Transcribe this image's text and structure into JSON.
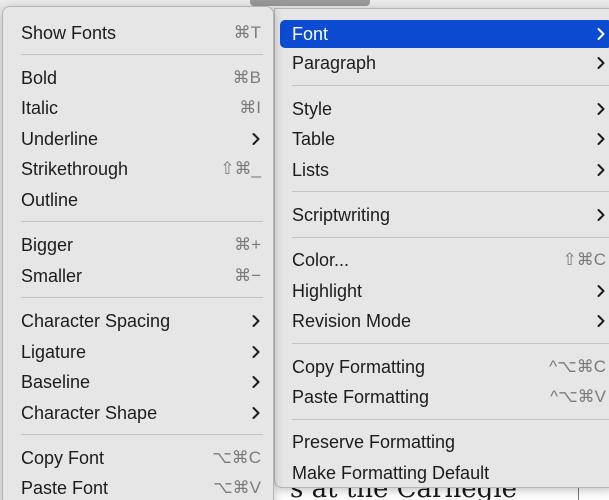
{
  "colors": {
    "accent": "#0a4bd1",
    "menu_bg": "#e6e6e6",
    "shortcut_gray": "#7b7b7b"
  },
  "document": {
    "visible_text": "s at the Carnegie"
  },
  "left_menu": {
    "items": [
      {
        "label": "Show Fonts",
        "shortcut": "⌘T"
      },
      {
        "label": "Bold",
        "shortcut": "⌘B"
      },
      {
        "label": "Italic",
        "shortcut": "⌘I"
      },
      {
        "label": "Underline",
        "submenu": true
      },
      {
        "label": "Strikethrough",
        "shortcut": "⇧⌘_"
      },
      {
        "label": "Outline"
      },
      {
        "label": "Bigger",
        "shortcut": "⌘+"
      },
      {
        "label": "Smaller",
        "shortcut": "⌘−"
      },
      {
        "label": "Character Spacing",
        "submenu": true
      },
      {
        "label": "Ligature",
        "submenu": true
      },
      {
        "label": "Baseline",
        "submenu": true
      },
      {
        "label": "Character Shape",
        "submenu": true
      },
      {
        "label": "Copy Font",
        "shortcut": "⌥⌘C"
      },
      {
        "label": "Paste Font",
        "shortcut": "⌥⌘V"
      }
    ]
  },
  "right_menu": {
    "items": [
      {
        "label": "Font",
        "submenu": true,
        "highlighted": true
      },
      {
        "label": "Paragraph",
        "submenu": true
      },
      {
        "label": "Style",
        "submenu": true
      },
      {
        "label": "Table",
        "submenu": true
      },
      {
        "label": "Lists",
        "submenu": true
      },
      {
        "label": "Scriptwriting",
        "submenu": true
      },
      {
        "label": "Color...",
        "shortcut": "⇧⌘C"
      },
      {
        "label": "Highlight",
        "submenu": true
      },
      {
        "label": "Revision Mode",
        "submenu": true
      },
      {
        "label": "Copy Formatting",
        "shortcut": "^⌥⌘C"
      },
      {
        "label": "Paste Formatting",
        "shortcut": "^⌥⌘V"
      },
      {
        "label": "Preserve Formatting"
      },
      {
        "label": "Make Formatting Default"
      }
    ]
  }
}
